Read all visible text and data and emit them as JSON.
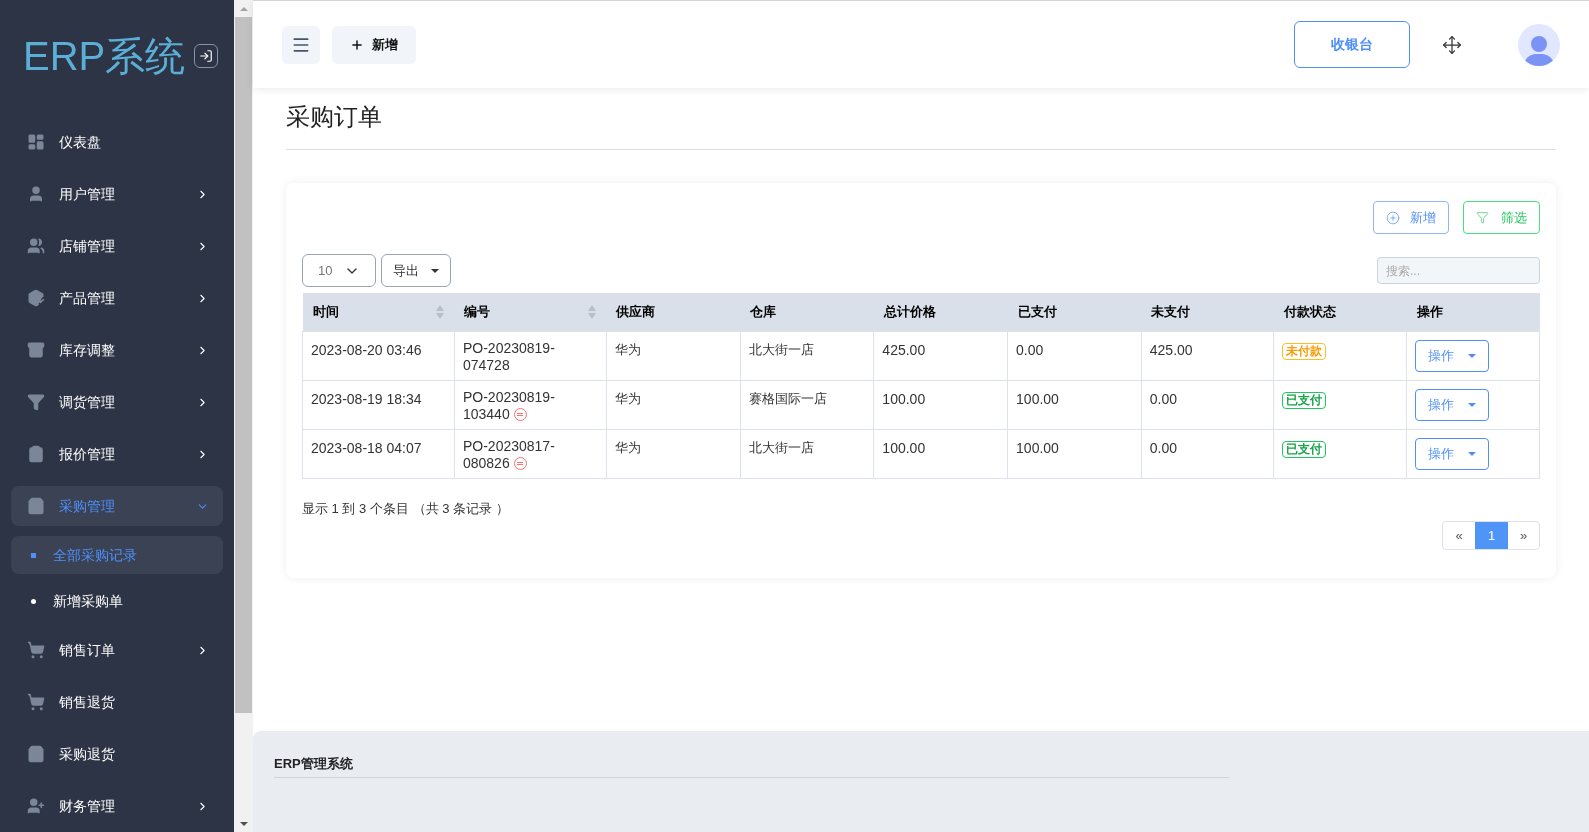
{
  "sidebar": {
    "logo": "ERP系统",
    "items": [
      {
        "label": "仪表盘",
        "expandable": false,
        "expanded": false,
        "selected": false
      },
      {
        "label": "用户管理",
        "expandable": true,
        "expanded": false,
        "selected": false
      },
      {
        "label": "店铺管理",
        "expandable": true,
        "expanded": false,
        "selected": false
      },
      {
        "label": "产品管理",
        "expandable": true,
        "expanded": false,
        "selected": false
      },
      {
        "label": "库存调整",
        "expandable": true,
        "expanded": false,
        "selected": false
      },
      {
        "label": "调货管理",
        "expandable": true,
        "expanded": false,
        "selected": false
      },
      {
        "label": "报价管理",
        "expandable": true,
        "expanded": false,
        "selected": false
      },
      {
        "label": "采购管理",
        "expandable": true,
        "expanded": true,
        "selected": true,
        "children": [
          {
            "label": "全部采购记录",
            "selected": true
          },
          {
            "label": "新增采购单",
            "selected": false
          }
        ]
      },
      {
        "label": "销售订单",
        "expandable": true,
        "expanded": false,
        "selected": false
      },
      {
        "label": "销售退货",
        "expandable": false,
        "expanded": false,
        "selected": false
      },
      {
        "label": "采购退货",
        "expandable": false,
        "expanded": false,
        "selected": false
      },
      {
        "label": "财务管理",
        "expandable": true,
        "expanded": false,
        "selected": false
      }
    ]
  },
  "header": {
    "new_button": "新增",
    "cashier_button": "收银台"
  },
  "page_title": "采购订单",
  "card": {
    "add_button": "新增",
    "filter_button": "筛选",
    "page_size": "10",
    "export_button": "导出",
    "search": {
      "placeholder": "搜索..."
    },
    "table": {
      "columns": [
        {
          "label": "时间",
          "sortable": true
        },
        {
          "label": "编号",
          "sortable": true
        },
        {
          "label": "供应商",
          "sortable": false
        },
        {
          "label": "仓库",
          "sortable": false
        },
        {
          "label": "总计价格",
          "sortable": false
        },
        {
          "label": "已支付",
          "sortable": false
        },
        {
          "label": "未支付",
          "sortable": false
        },
        {
          "label": "付款状态",
          "sortable": false
        },
        {
          "label": "操作",
          "sortable": false
        }
      ],
      "rows": [
        {
          "time": "2023-08-20 03:46",
          "number": "PO-20230819-074728",
          "refund_mark": false,
          "supplier": "华为",
          "warehouse": "北大街一店",
          "total": "425.00",
          "paid": "0.00",
          "unpaid": "425.00",
          "status": {
            "label": "未付款",
            "kind": "unpaid"
          },
          "action": "操作"
        },
        {
          "time": "2023-08-19 18:34",
          "number": "PO-20230819-103440",
          "refund_mark": true,
          "supplier": "华为",
          "warehouse": "赛格国际一店",
          "total": "100.00",
          "paid": "100.00",
          "unpaid": "0.00",
          "status": {
            "label": "已支付",
            "kind": "paid"
          },
          "action": "操作"
        },
        {
          "time": "2023-08-18 04:07",
          "number": "PO-20230817-080826",
          "refund_mark": true,
          "supplier": "华为",
          "warehouse": "北大街一店",
          "total": "100.00",
          "paid": "100.00",
          "unpaid": "0.00",
          "status": {
            "label": "已支付",
            "kind": "paid"
          },
          "action": "操作"
        }
      ]
    },
    "summary": "显示 1 到 3 个条目 （共 3 条记录 ）",
    "pagination": {
      "prev": "«",
      "pages": [
        {
          "label": "1",
          "selected": true
        }
      ],
      "next": "»"
    }
  },
  "footer": "ERP管理系统"
}
